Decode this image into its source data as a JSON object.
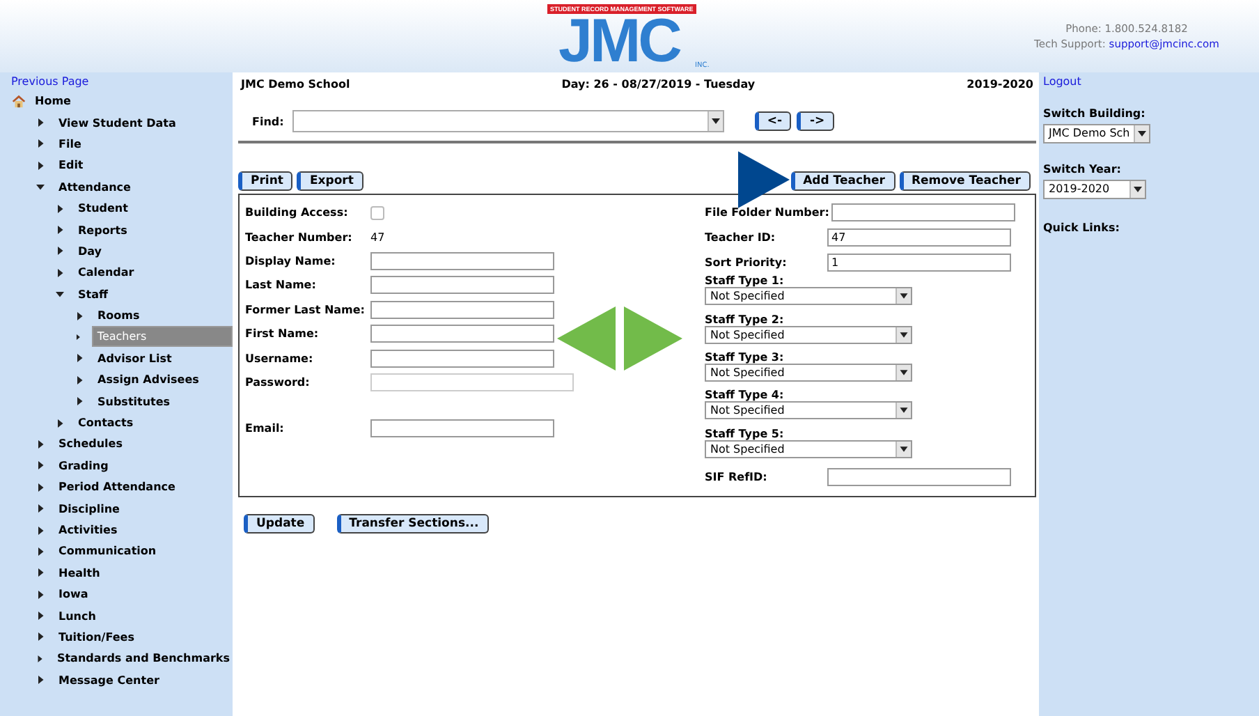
{
  "header": {
    "logo": {
      "name": "JMC",
      "banner": "STUDENT RECORD MANAGEMENT SOFTWARE",
      "suffix": "INC."
    },
    "phone": "Phone: 1.800.524.8182",
    "support_label": "Tech Support:",
    "support_link": "support@jmcinc.com"
  },
  "sidebar": {
    "previous": "Previous Page",
    "tree": [
      {
        "label": "Home",
        "kind": "home",
        "selected": false,
        "children": [
          {
            "label": "View Student Data",
            "expanded": false,
            "selected": false
          },
          {
            "label": "File",
            "expanded": false,
            "selected": false
          },
          {
            "label": "Edit",
            "expanded": false,
            "selected": false
          },
          {
            "label": "Attendance",
            "expanded": true,
            "selected": false,
            "children": [
              {
                "label": "Student",
                "expanded": false,
                "selected": false
              },
              {
                "label": "Reports",
                "expanded": false,
                "selected": false
              },
              {
                "label": "Day",
                "expanded": false,
                "selected": false
              },
              {
                "label": "Calendar",
                "expanded": false,
                "selected": false
              },
              {
                "label": "Staff",
                "expanded": true,
                "selected": false,
                "children": [
                  {
                    "label": "Rooms",
                    "expanded": false,
                    "selected": false
                  },
                  {
                    "label": "Teachers",
                    "expanded": false,
                    "selected": true
                  },
                  {
                    "label": "Advisor List",
                    "expanded": false,
                    "selected": false
                  },
                  {
                    "label": "Assign Advisees",
                    "expanded": false,
                    "selected": false
                  },
                  {
                    "label": "Substitutes",
                    "expanded": false,
                    "selected": false
                  }
                ]
              },
              {
                "label": "Contacts",
                "expanded": false,
                "selected": false
              }
            ]
          },
          {
            "label": "Schedules",
            "expanded": false,
            "selected": false
          },
          {
            "label": "Grading",
            "expanded": false,
            "selected": false
          },
          {
            "label": "Period Attendance",
            "expanded": false,
            "selected": false
          },
          {
            "label": "Discipline",
            "expanded": false,
            "selected": false
          },
          {
            "label": "Activities",
            "expanded": false,
            "selected": false
          },
          {
            "label": "Communication",
            "expanded": false,
            "selected": false
          },
          {
            "label": "Health",
            "expanded": false,
            "selected": false
          },
          {
            "label": "Iowa",
            "expanded": false,
            "selected": false
          },
          {
            "label": "Lunch",
            "expanded": false,
            "selected": false
          },
          {
            "label": "Tuition/Fees",
            "expanded": false,
            "selected": false
          },
          {
            "label": "Standards and Benchmarks",
            "expanded": false,
            "selected": false
          },
          {
            "label": "Message Center",
            "expanded": false,
            "selected": false
          }
        ]
      }
    ]
  },
  "topbar": {
    "school": "JMC Demo School",
    "day": "Day: 26 - 08/27/2019 - Tuesday",
    "year": "2019-2020"
  },
  "find": {
    "label": "Find:",
    "prev": "<-",
    "next": "->"
  },
  "toolbar": {
    "left": [
      "Print",
      "Export"
    ],
    "right": [
      "Add Teacher",
      "Remove Teacher"
    ]
  },
  "form": {
    "left": [
      {
        "kind": "checkbox",
        "label": "Building Access:",
        "checked": false
      },
      {
        "kind": "static",
        "label": "Teacher Number:",
        "value": "47"
      },
      {
        "kind": "input",
        "label": "Display Name:"
      },
      {
        "kind": "input",
        "label": "Last Name:"
      },
      {
        "kind": "input",
        "label": "Former Last Name:"
      },
      {
        "kind": "input",
        "label": "First Name:"
      },
      {
        "kind": "input",
        "label": "Username:"
      },
      {
        "kind": "password",
        "label": "Password:"
      },
      {
        "kind": "gap"
      },
      {
        "kind": "input",
        "label": "Email:"
      }
    ],
    "right": [
      {
        "kind": "input",
        "label": "File Folder Number:"
      },
      {
        "kind": "input",
        "label": "Teacher ID:",
        "value": "47"
      },
      {
        "kind": "input",
        "label": "Sort Priority:",
        "value": "1"
      },
      {
        "kind": "select",
        "label": "Staff Type 1:",
        "value": "Not Specified"
      },
      {
        "kind": "select",
        "label": "Staff Type 2:",
        "value": "Not Specified"
      },
      {
        "kind": "select",
        "label": "Staff Type 3:",
        "value": "Not Specified"
      },
      {
        "kind": "select",
        "label": "Staff Type 4:",
        "value": "Not Specified"
      },
      {
        "kind": "select",
        "label": "Staff Type 5:",
        "value": "Not Specified"
      },
      {
        "kind": "input",
        "label": "SIF RefID:"
      }
    ]
  },
  "actions": [
    "Update",
    "Transfer Sections..."
  ],
  "right_panel": {
    "logout": "Logout",
    "building_label": "Switch Building:",
    "building": "JMC Demo Sch",
    "year_label": "Switch Year:",
    "year": "2019-2020",
    "quick_links": "Quick Links:"
  }
}
